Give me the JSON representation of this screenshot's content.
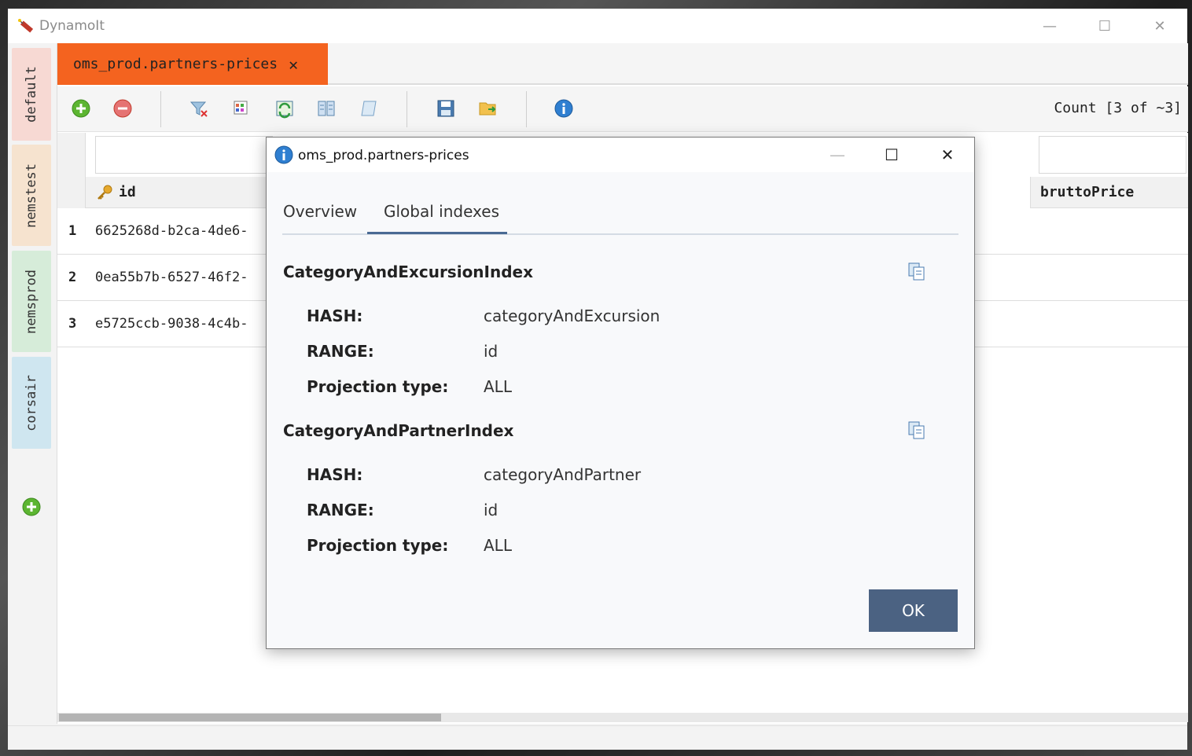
{
  "app": {
    "title": "DynamoIt"
  },
  "window_controls": {
    "minimize": "—",
    "maximize": "☐",
    "close": "✕"
  },
  "profiles": [
    {
      "label": "default",
      "color": "#f7d9d3"
    },
    {
      "label": "nemstest",
      "color": "#f6e3cf"
    },
    {
      "label": "nemsprod",
      "color": "#d6ecd9"
    },
    {
      "label": "corsair",
      "color": "#cfe6f0"
    }
  ],
  "tab": {
    "label": "oms_prod.partners-prices",
    "close": "✕",
    "color": "#f4631f"
  },
  "toolbar": {
    "count_label": "Count [3 of ~3]"
  },
  "grid": {
    "columns": {
      "id": "id",
      "brutto": "bruttoPrice"
    },
    "rows": [
      {
        "num": "1",
        "id": "6625268d-b2ca-4de6-"
      },
      {
        "num": "2",
        "id": "0ea55b7b-6527-46f2-"
      },
      {
        "num": "3",
        "id": "e5725ccb-9038-4c4b-"
      }
    ]
  },
  "dialog": {
    "title": "oms_prod.partners-prices",
    "tabs": {
      "overview": "Overview",
      "global": "Global indexes"
    },
    "labels": {
      "hash": "HASH:",
      "range": "RANGE:",
      "projection": "Projection type:"
    },
    "indexes": [
      {
        "name": "CategoryAndExcursionIndex",
        "hash": "categoryAndExcursion",
        "range": "id",
        "projection": "ALL"
      },
      {
        "name": "CategoryAndPartnerIndex",
        "hash": "categoryAndPartner",
        "range": "id",
        "projection": "ALL"
      }
    ],
    "ok": "OK",
    "controls": {
      "minimize": "—",
      "maximize": "☐",
      "close": "✕"
    }
  }
}
